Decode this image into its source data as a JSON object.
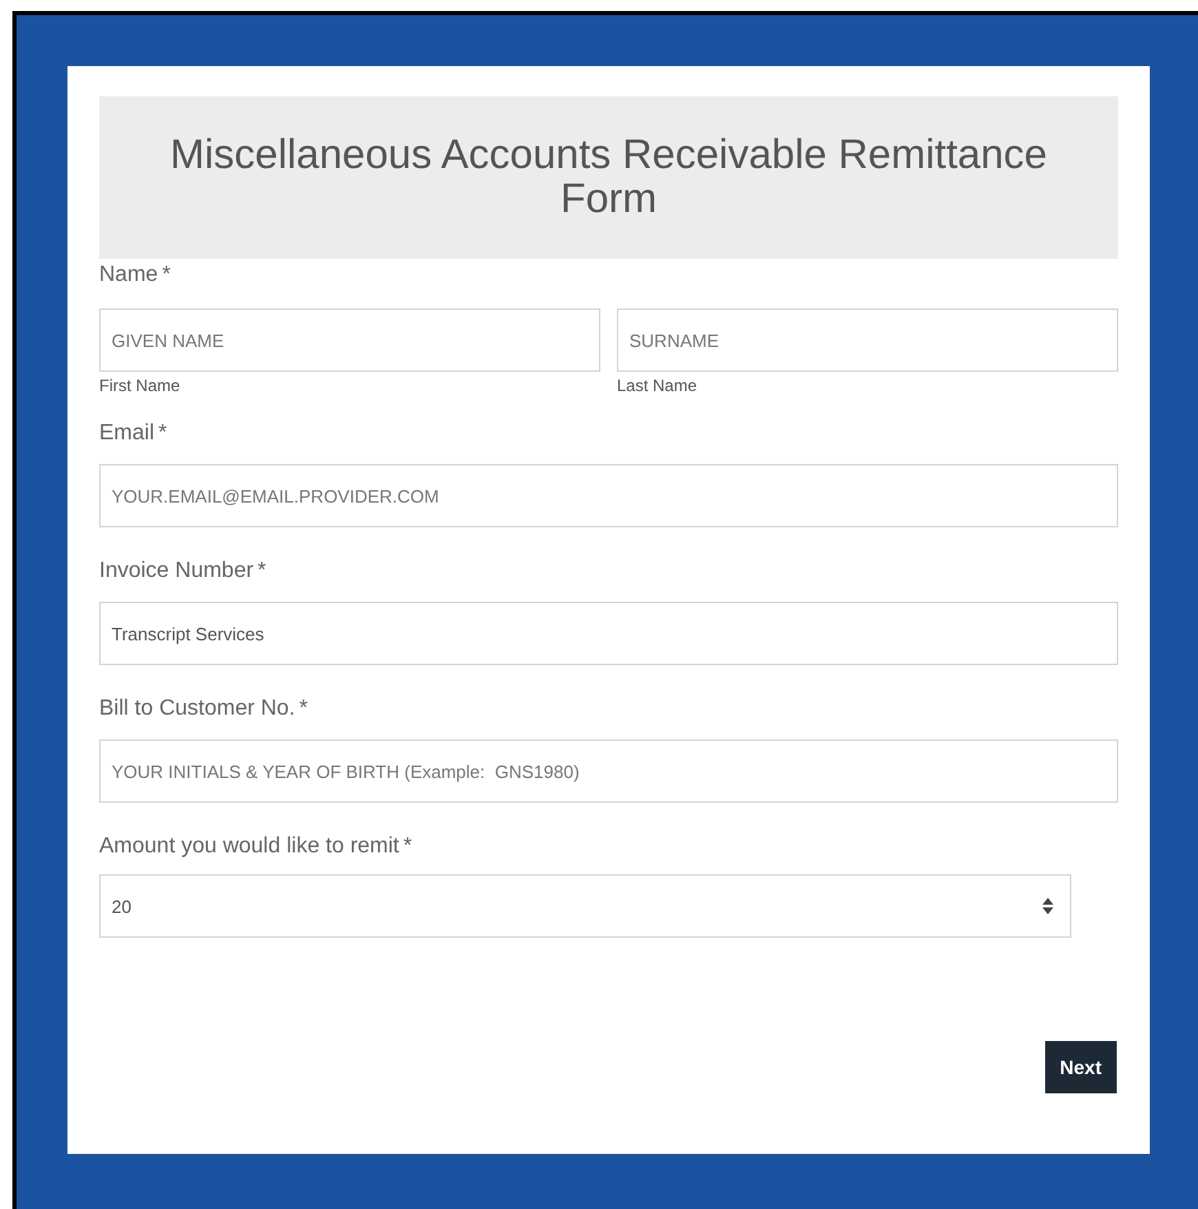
{
  "title": "Miscellaneous Accounts Receivable Remittance Form",
  "fields": [
    {
      "kind": "name",
      "label": "Name",
      "required_mark": "*",
      "parts": [
        {
          "placeholder": "GIVEN NAME",
          "sublabel": "First Name"
        },
        {
          "placeholder": "SURNAME",
          "sublabel": "Last Name"
        }
      ]
    },
    {
      "kind": "text",
      "label": "Email",
      "required_mark": "*",
      "placeholder": "YOUR.EMAIL@EMAIL.PROVIDER.COM"
    },
    {
      "kind": "text",
      "label": "Invoice Number",
      "required_mark": "*",
      "value": "Transcript Services"
    },
    {
      "kind": "text",
      "label": "Bill to Customer No.",
      "required_mark": "*",
      "placeholder": "YOUR INITIALS & YEAR OF BIRTH (Example:  GNS1980)"
    },
    {
      "kind": "number",
      "label": "Amount you would like to remit",
      "required_mark": "*",
      "value": "20"
    }
  ],
  "buttons": [
    {
      "label": "Next"
    }
  ]
}
